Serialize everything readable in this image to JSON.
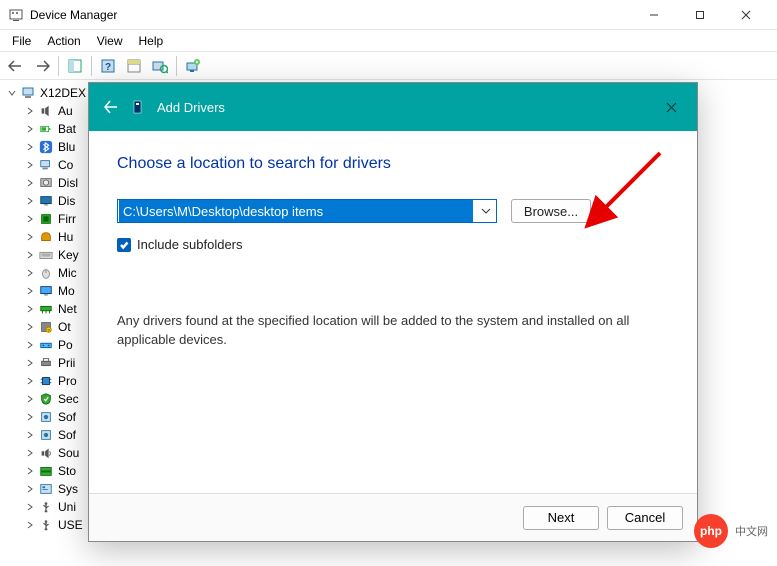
{
  "window": {
    "title": "Device Manager"
  },
  "menubar": [
    "File",
    "Action",
    "View",
    "Help"
  ],
  "tree": {
    "root": "X12DEX",
    "items": [
      {
        "label": "Au",
        "icon": "audio"
      },
      {
        "label": "Bat",
        "icon": "battery"
      },
      {
        "label": "Blu",
        "icon": "bluetooth"
      },
      {
        "label": "Co",
        "icon": "computer"
      },
      {
        "label": "Disl",
        "icon": "disk"
      },
      {
        "label": "Dis",
        "icon": "display"
      },
      {
        "label": "Firr",
        "icon": "firmware"
      },
      {
        "label": "Hu",
        "icon": "hid"
      },
      {
        "label": "Key",
        "icon": "keyboard"
      },
      {
        "label": "Mic",
        "icon": "mouse"
      },
      {
        "label": "Mo",
        "icon": "monitor"
      },
      {
        "label": "Net",
        "icon": "network"
      },
      {
        "label": "Ot",
        "icon": "other"
      },
      {
        "label": "Po",
        "icon": "port"
      },
      {
        "label": "Prii",
        "icon": "printqueue"
      },
      {
        "label": "Pro",
        "icon": "processor"
      },
      {
        "label": "Sec",
        "icon": "security"
      },
      {
        "label": "Sof",
        "icon": "software"
      },
      {
        "label": "Sof",
        "icon": "software"
      },
      {
        "label": "Sou",
        "icon": "sound"
      },
      {
        "label": "Sto",
        "icon": "storage"
      },
      {
        "label": "Sys",
        "icon": "system"
      },
      {
        "label": "Uni",
        "icon": "usb"
      },
      {
        "label": "USE",
        "icon": "usb"
      }
    ]
  },
  "dialog": {
    "title": "Add Drivers",
    "heading": "Choose a location to search for drivers",
    "path_value": "C:\\Users\\M\\Desktop\\desktop items",
    "browse_label": "Browse...",
    "include_subfolders_label": "Include subfolders",
    "hint": "Any drivers found at the specified location will be added to the system and installed on all applicable devices.",
    "next_label": "Next",
    "cancel_label": "Cancel"
  },
  "watermark": {
    "badge": "php",
    "text": "中文网"
  }
}
